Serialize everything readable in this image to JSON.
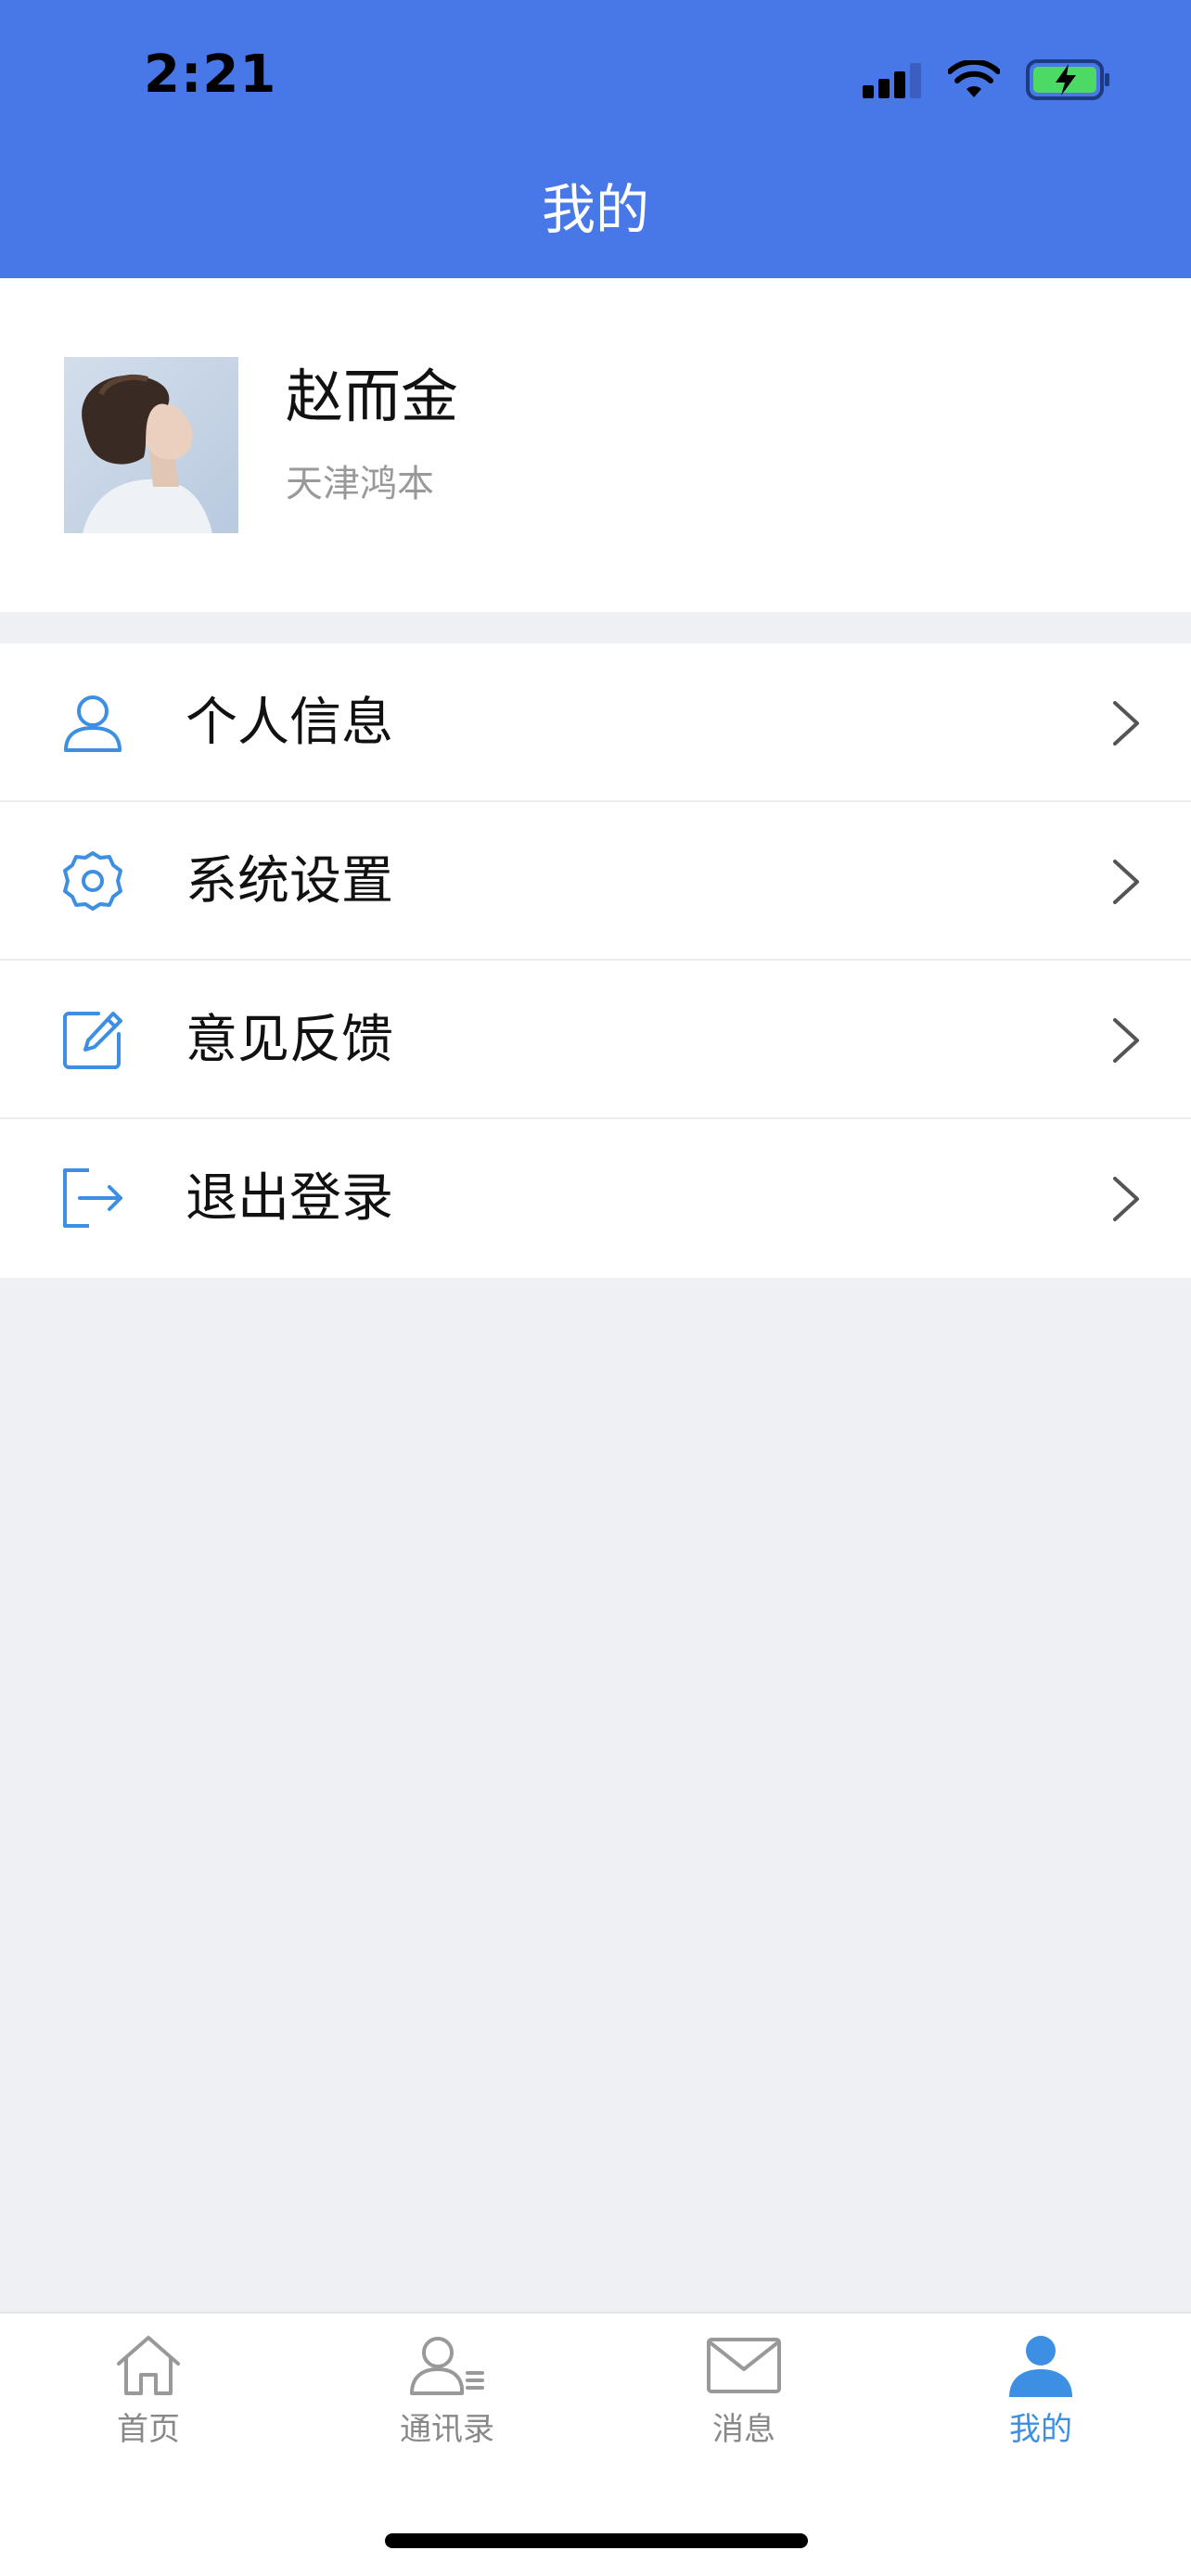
{
  "status_bar": {
    "time": "2:21"
  },
  "header": {
    "title": "我的"
  },
  "profile": {
    "name": "赵而金",
    "company": "天津鸿本"
  },
  "menu": [
    {
      "label": "个人信息",
      "icon": "user-icon"
    },
    {
      "label": "系统设置",
      "icon": "gear-icon"
    },
    {
      "label": "意见反馈",
      "icon": "edit-icon"
    },
    {
      "label": "退出登录",
      "icon": "logout-icon"
    }
  ],
  "tabbar": [
    {
      "label": "首页",
      "icon": "home-icon"
    },
    {
      "label": "通讯录",
      "icon": "contacts-icon"
    },
    {
      "label": "消息",
      "icon": "mail-icon"
    },
    {
      "label": "我的",
      "icon": "user-filled-icon",
      "active": true
    }
  ],
  "colors": {
    "header_bg": "#4878e8",
    "accent": "#3d8fe4",
    "page_bg": "#eff0f4",
    "battery_green": "#4cd964"
  }
}
